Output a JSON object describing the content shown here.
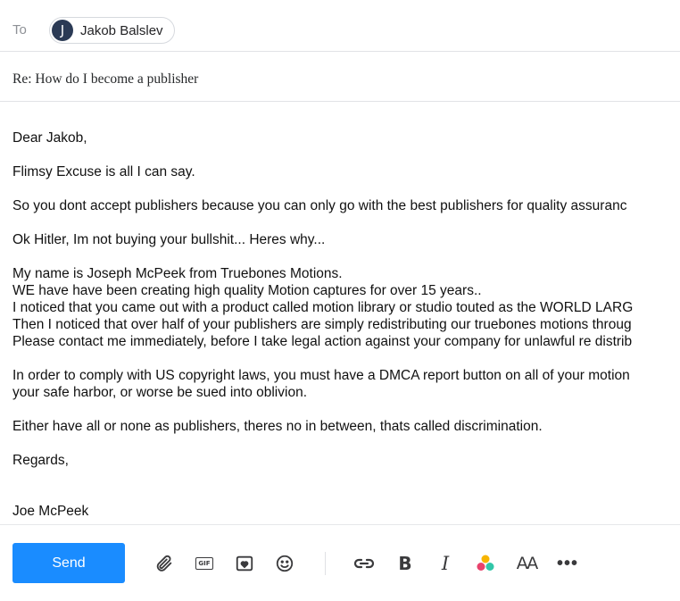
{
  "to": {
    "label": "To",
    "recipient": {
      "initial": "J",
      "name": "Jakob Balslev"
    }
  },
  "subject": "Re: How do I become a publisher",
  "body_lines": [
    "Dear Jakob,",
    "",
    "Flimsy Excuse is all I can say.",
    "",
    "So you dont accept publishers because you can only go with the best publishers for quality assuranc",
    "",
    "Ok Hitler, Im not buying your bullshit... Heres why...",
    "",
    "My name is Joseph McPeek from Truebones Motions.",
    "WE have have been creating high quality Motion captures for over 15 years..",
    "I noticed that you came out with a product called motion library or studio touted as the WORLD LARG",
    "Then I noticed that over half of your publishers are simply redistributing our truebones motions throug",
    "Please contact me immediately, before I take legal action against your company for unlawful re distrib",
    "",
    "In order to comply with US copyright laws, you must have a DMCA report button on all of your motion",
    "your safe harbor, or worse be sued into oblivion.",
    "",
    "Either have all or none as publishers, theres no in between, thats called discrimination.",
    "",
    "Regards,",
    "",
    "",
    "Joe McPeek"
  ],
  "toolbar": {
    "send_label": "Send",
    "gif_label": "GIF",
    "bold_label": "B",
    "italic_label": "I",
    "font_size_label": "AA",
    "more_label": "•••"
  },
  "colors": {
    "accent": "#1a8cff",
    "avatar": "#2b3a55"
  }
}
